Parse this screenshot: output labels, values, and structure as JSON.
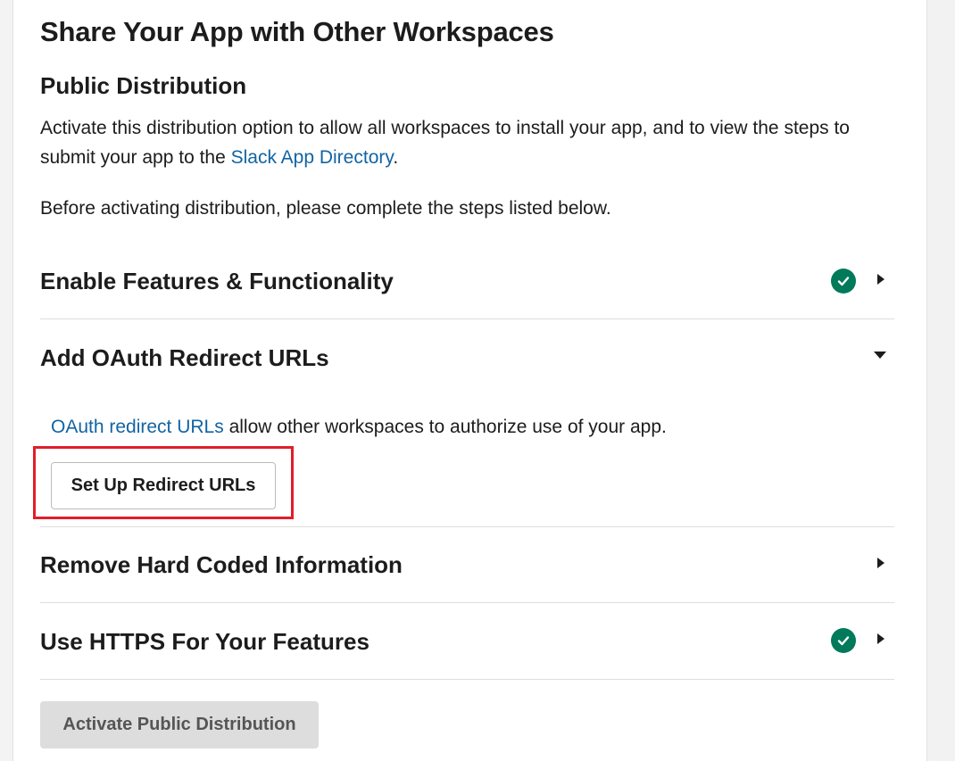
{
  "page": {
    "title": "Share Your App with Other Workspaces",
    "subtitle": "Public Distribution",
    "intro_before_link": "Activate this distribution option to allow all workspaces to install your app, and to view the steps to submit your app to the ",
    "intro_link": "Slack App Directory",
    "intro_after_link": ".",
    "instruction": "Before activating distribution, please complete the steps listed below."
  },
  "steps": [
    {
      "title": "Enable Features & Functionality",
      "completed": true,
      "expanded": false,
      "icon": "check-circle-icon"
    },
    {
      "title": "Add OAuth Redirect URLs",
      "completed": false,
      "expanded": true
    },
    {
      "title": "Remove Hard Coded Information",
      "completed": false,
      "expanded": false
    },
    {
      "title": "Use HTTPS For Your Features",
      "completed": true,
      "expanded": false,
      "icon": "check-circle-icon"
    }
  ],
  "oauth": {
    "link_text": "OAuth redirect URLs",
    "description": " allow other workspaces to authorize use of your app.",
    "button_label": "Set Up Redirect URLs"
  },
  "activate_button_label": "Activate Public Distribution",
  "colors": {
    "link": "#1264a3",
    "check": "#007a5a",
    "highlight": "#e01e2a",
    "disabled_button": "#dddddd"
  }
}
